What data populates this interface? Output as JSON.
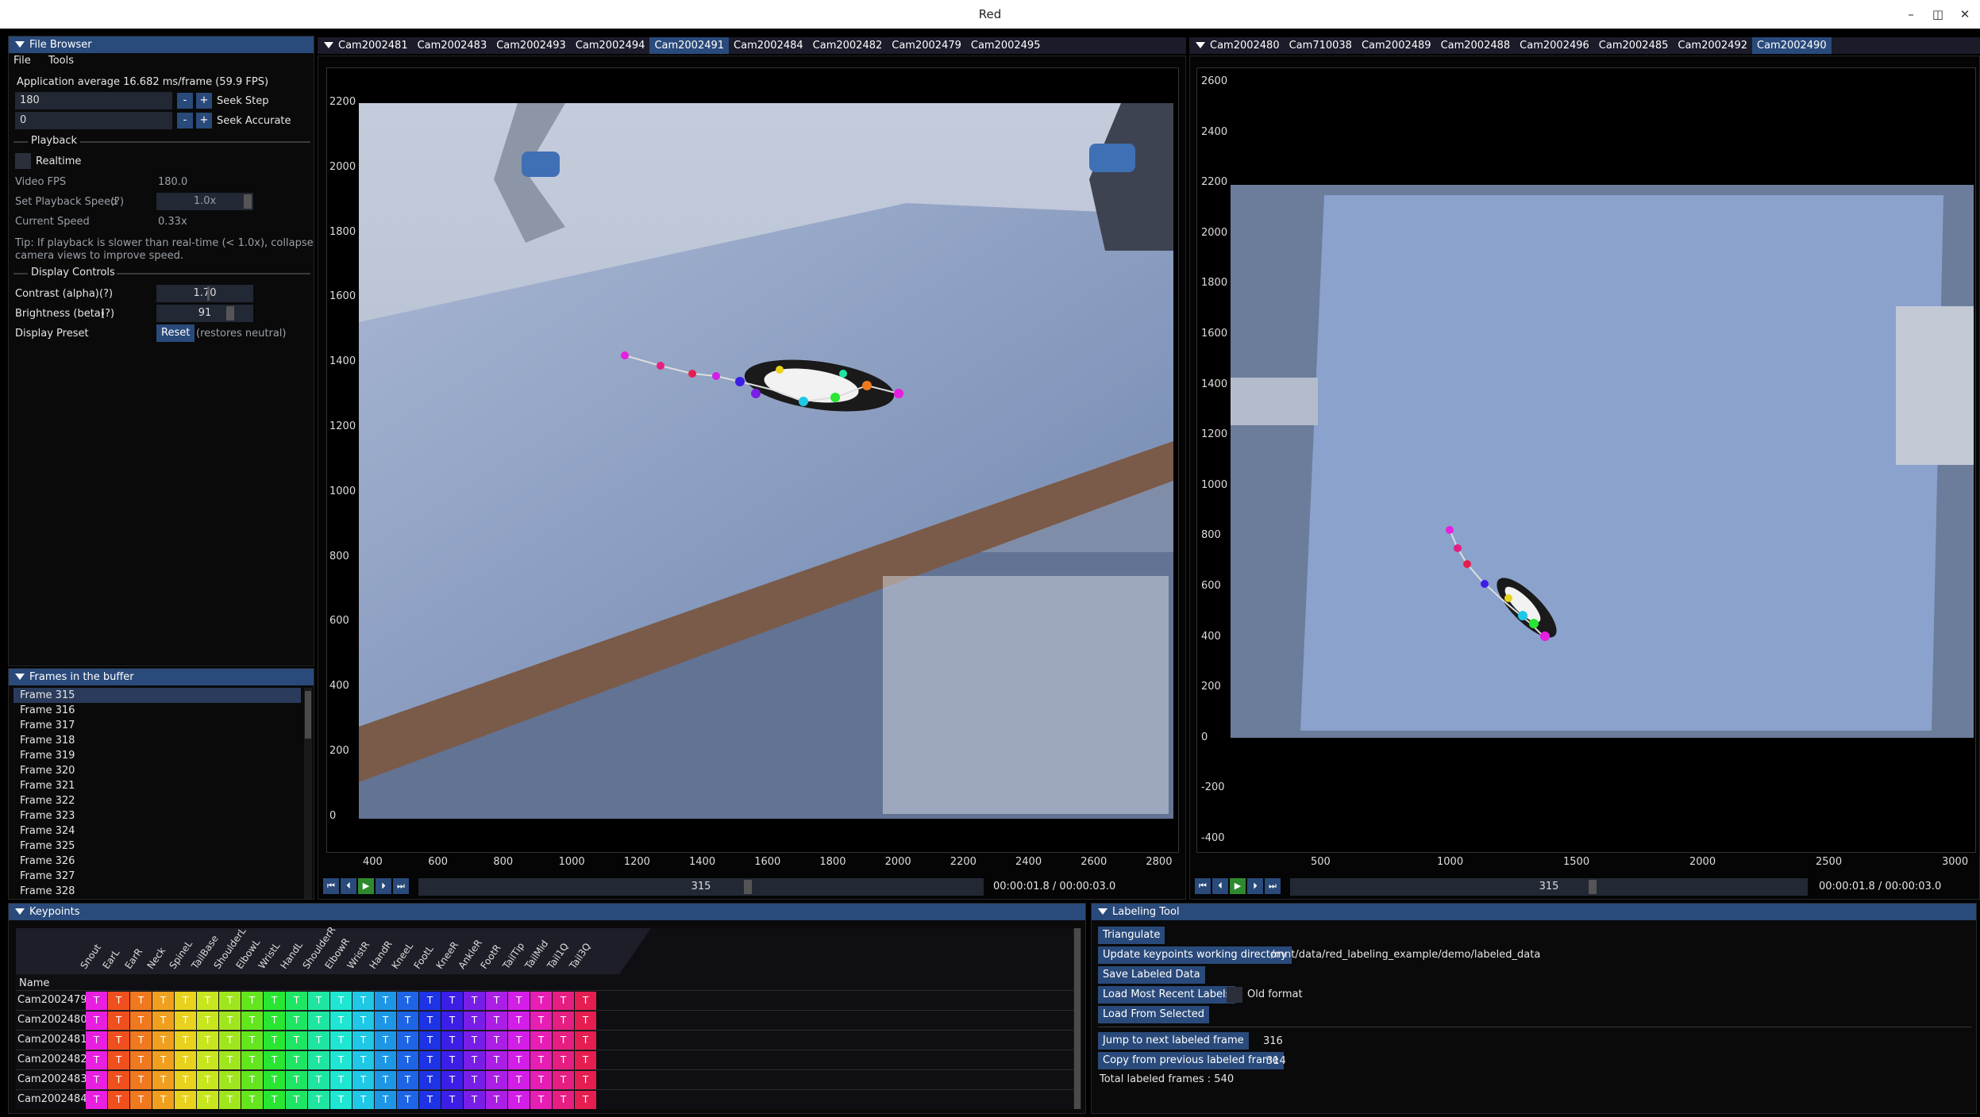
{
  "window": {
    "title": "Red"
  },
  "file_browser": {
    "title": "File Browser",
    "menu": [
      "File",
      "Tools"
    ],
    "app_average": "Application average 16.682 ms/frame (59.9 FPS)",
    "seek_step": {
      "value": "180",
      "label": "Seek Step"
    },
    "seek_accurate": {
      "value": "0",
      "label": "Seek Accurate"
    },
    "playback_header": "Playback",
    "realtime_label": "Realtime",
    "video_fps": {
      "label": "Video FPS",
      "value": "180.0"
    },
    "playback_speed": {
      "label": "Set Playback Speed",
      "help": "(?)",
      "value": "1.0x"
    },
    "current_speed": {
      "label": "Current Speed",
      "value": "0.33x"
    },
    "tip_line1": "Tip: If playback is slower than real-time (< 1.0x), collapse",
    "tip_line2": "camera views to improve speed.",
    "display_header": "Display Controls",
    "contrast": {
      "label": "Contrast (alpha)",
      "help": "(?)",
      "value": "1.70"
    },
    "brightness": {
      "label": "Brightness (beta)",
      "help": "(?)",
      "value": "91"
    },
    "preset": {
      "label": "Display Preset",
      "button": "Reset",
      "note": "(restores neutral)"
    }
  },
  "frames_panel": {
    "title": "Frames in the buffer",
    "frames": [
      "Frame 315",
      "Frame 316",
      "Frame 317",
      "Frame 318",
      "Frame 319",
      "Frame 320",
      "Frame 321",
      "Frame 322",
      "Frame 323",
      "Frame 324",
      "Frame 325",
      "Frame 326",
      "Frame 327",
      "Frame 328"
    ]
  },
  "left_view": {
    "tabs": [
      "Cam2002481",
      "Cam2002483",
      "Cam2002493",
      "Cam2002494",
      "Cam2002491",
      "Cam2002484",
      "Cam2002482",
      "Cam2002479",
      "Cam2002495"
    ],
    "active_tab": "Cam2002491",
    "y_ticks": [
      "2200",
      "2000",
      "1800",
      "1600",
      "1400",
      "1200",
      "1000",
      "800",
      "600",
      "400",
      "200",
      "0"
    ],
    "x_ticks": [
      "400",
      "600",
      "800",
      "1000",
      "1200",
      "1400",
      "1600",
      "1800",
      "2000",
      "2200",
      "2400",
      "2600",
      "2800"
    ],
    "frame": "315",
    "time": "00:00:01.8 / 00:00:03.0"
  },
  "right_view": {
    "tabs": [
      "Cam2002480",
      "Cam710038",
      "Cam2002489",
      "Cam2002488",
      "Cam2002496",
      "Cam2002485",
      "Cam2002492",
      "Cam2002490"
    ],
    "active_tab": "Cam2002490",
    "y_ticks": [
      "2600",
      "2400",
      "2200",
      "2000",
      "1800",
      "1600",
      "1400",
      "1200",
      "1000",
      "800",
      "600",
      "400",
      "200",
      "0",
      "-200",
      "-400"
    ],
    "x_ticks": [
      "500",
      "1000",
      "1500",
      "2000",
      "2500",
      "3000"
    ],
    "frame": "315",
    "time": "00:00:01.8 / 00:00:03.0"
  },
  "keypoints": {
    "title": "Keypoints",
    "columns": [
      "Snout",
      "EarL",
      "EarR",
      "Neck",
      "SpineL",
      "TailBase",
      "ShoulderL",
      "ElbowL",
      "WristL",
      "HandL",
      "ShoulderR",
      "ElbowR",
      "WristR",
      "HandR",
      "KneeL",
      "FootL",
      "KneeR",
      "AnkleR",
      "FootR",
      "TailTip",
      "TailMid",
      "Tail1Q",
      "Tail3Q"
    ],
    "name_header": "Name",
    "rows": [
      "Cam2002479",
      "Cam2002480",
      "Cam2002481",
      "Cam2002482",
      "Cam2002483",
      "Cam2002484"
    ],
    "cell_text": "T",
    "colors": [
      "#e81ee0",
      "#f0501e",
      "#f0781e",
      "#f0a01e",
      "#e8d21e",
      "#c8e61e",
      "#a0e61e",
      "#64e61e",
      "#28e632",
      "#1ee664",
      "#1ee6a0",
      "#1ee6d2",
      "#1ec8e6",
      "#1e96e6",
      "#1e64e6",
      "#1e32e6",
      "#3c1ee6",
      "#781ee6",
      "#aa1ee6",
      "#d21ee6",
      "#e61eb4",
      "#e61e82",
      "#e61e50"
    ]
  },
  "labeling_tool": {
    "title": "Labeling Tool",
    "triangulate": "Triangulate",
    "update_dir": "Update keypoints working directory",
    "dir_path": "/mnt/data/red_labeling_example/demo/labeled_data",
    "save": "Save Labeled Data",
    "load_recent": "Load Most Recent Labels",
    "old_format": "Old format",
    "load_selected": "Load From Selected",
    "jump_next": "Jump to next labeled frame",
    "jump_value": "316",
    "copy_prev": "Copy from previous labeled frame",
    "copy_value": "314",
    "total": "Total labeled frames : 540"
  }
}
